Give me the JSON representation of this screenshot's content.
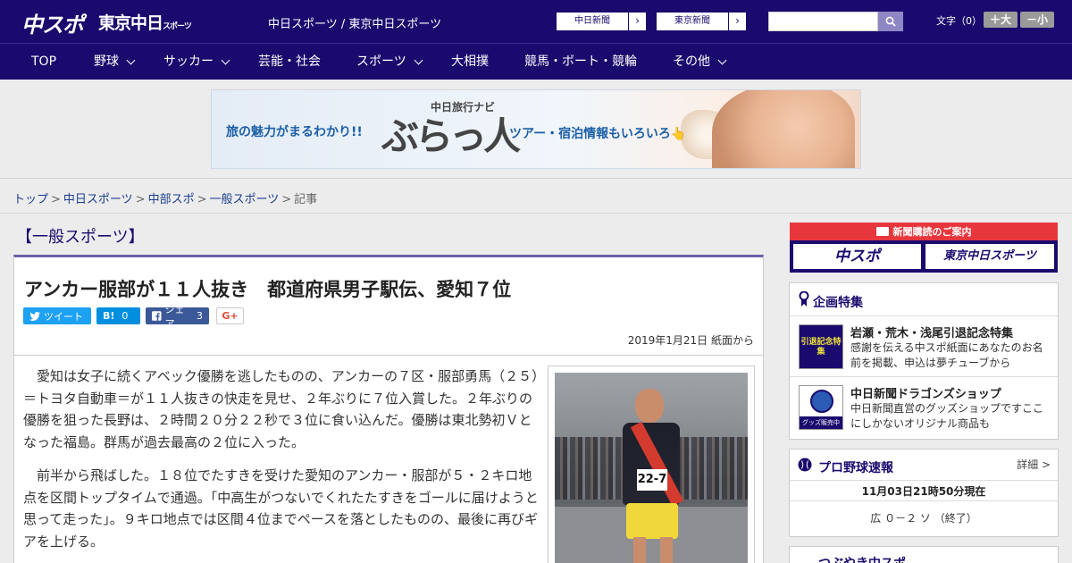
{
  "header": {
    "logo_primary": "中スポ",
    "logo_secondary": "東京中日",
    "logo_secondary_suffix": "スポーツ",
    "site_title": "中日スポーツ / 東京中日スポーツ",
    "links": [
      {
        "label": "中日新聞"
      },
      {
        "label": "東京新聞"
      }
    ],
    "search": {
      "value": "",
      "icon": "search-icon"
    },
    "font_size": {
      "label": "文字（0）",
      "increase": "＋大",
      "decrease": "－小"
    },
    "brand_color": "#1a0a6e"
  },
  "nav": {
    "items": [
      {
        "label": "TOP",
        "has_menu": false
      },
      {
        "label": "野球",
        "has_menu": true
      },
      {
        "label": "サッカー",
        "has_menu": true
      },
      {
        "label": "芸能・社会",
        "has_menu": false
      },
      {
        "label": "スポーツ",
        "has_menu": true
      },
      {
        "label": "大相撲",
        "has_menu": false
      },
      {
        "label": "競馬・ボート・競輪",
        "has_menu": false
      },
      {
        "label": "その他",
        "has_menu": true
      }
    ]
  },
  "ad": {
    "left_text": "旅の魅力がまるわかり!!",
    "sub_title": "中日旅行ナビ",
    "main_title": "ぶらっ人",
    "right_text": "ツアー・宿泊情報もいろいろ👆"
  },
  "breadcrumb": [
    {
      "label": "トップ",
      "link": true
    },
    {
      "label": "中日スポーツ",
      "link": true
    },
    {
      "label": "中部スポ",
      "link": true
    },
    {
      "label": "一般スポーツ",
      "link": true
    },
    {
      "label": "記事",
      "link": false
    }
  ],
  "breadcrumb_sep": ">",
  "article": {
    "section": "【一般スポーツ】",
    "headline": "アンカー服部が１１人抜き　都道府県男子駅伝、愛知７位",
    "share": {
      "tweet": "ツイート",
      "hatena_icon": "B!",
      "hatena_count": "0",
      "facebook_label": "シェア",
      "facebook_count": "3",
      "gplus": "G+"
    },
    "date": "2019年1月21日 紙面から",
    "paragraphs": [
      "愛知は女子に続くアベック優勝を逃したものの、アンカーの７区・服部勇馬（２５）＝トヨタ自動車＝が１１人抜きの快走を見せ、２年ぶりに７位入賞した。２年ぶりの優勝を狙った長野は、２時間２０分２２秒で３位に食い込んだ。優勝は東北勢初Ｖとなった福島。群馬が過去最高の２位に入った。",
      "前半から飛ばした。１８位でたすきを受けた愛知のアンカー・服部が５・２キロ地点を区間トップタイムで通過。「中高生がつないでくれたたすきをゴールに届けようと思って走った」。９キロ地点では区間４位までペースを落としたものの、最後に再びギアを上げる。"
    ],
    "photo_bib": "22-7"
  },
  "sidebar": {
    "subscribe": {
      "title": "新聞購読のご案内",
      "buttons": [
        "中スポ",
        "東京中日スポーツ"
      ]
    },
    "features": {
      "title": "企画特集",
      "items": [
        {
          "title": "岩瀬・荒木・浅尾引退記念特集",
          "desc": "感謝を伝える中スポ紙面にあなたのお名前を掲載、申込は夢チューブから",
          "thumb": "引退記念特集"
        },
        {
          "title": "中日新聞ドラゴンズショップ",
          "desc": "中日新聞直営のグッズショップですここにしかないオリジナル商品も",
          "thumb": "グッズ販売中"
        }
      ]
    },
    "baseball": {
      "title": "プロ野球速報",
      "detail": "詳細 >",
      "updated": "11月03日21時50分現在",
      "score": "広 ０－２ ソ （終了）"
    },
    "next_title": "つぶやき中スポ"
  }
}
